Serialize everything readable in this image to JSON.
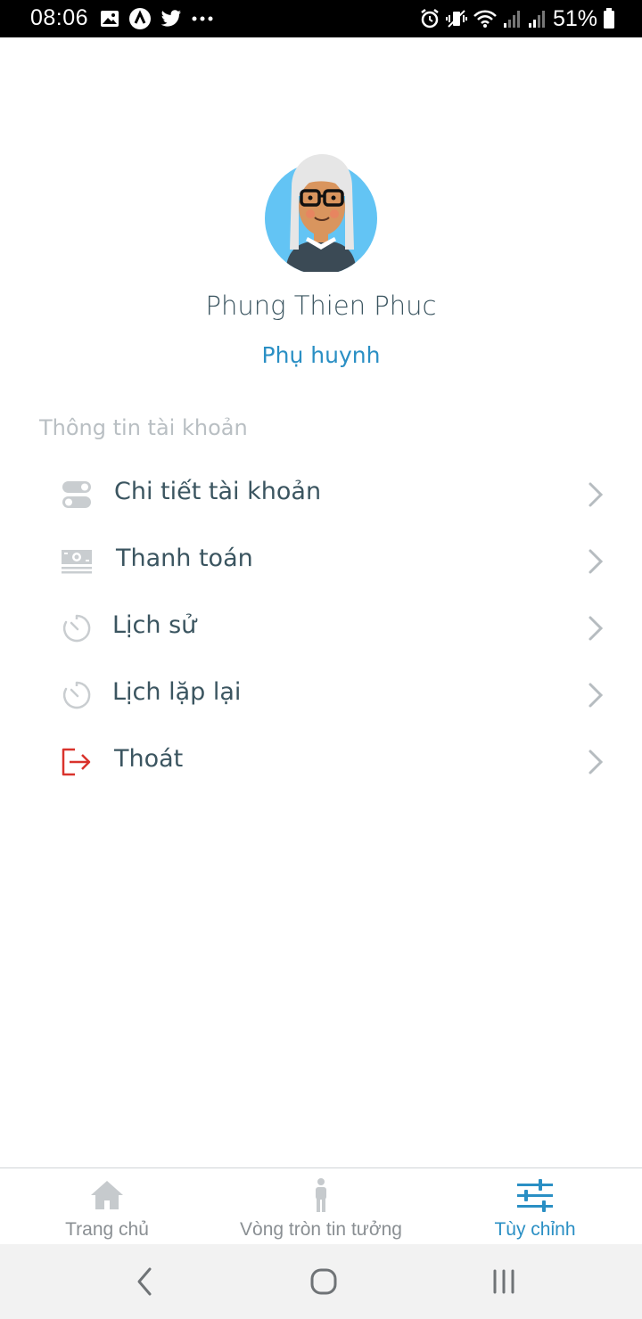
{
  "status_bar": {
    "time": "08:06",
    "battery": "51%",
    "left_icons": [
      "image-icon",
      "app-icon",
      "twitter-icon",
      "more-icon"
    ],
    "right_icons": [
      "alarm-icon",
      "vibrate-icon",
      "wifi-icon",
      "signal-icon",
      "signal-icon",
      "battery-icon"
    ]
  },
  "profile": {
    "name": "Phung Thien Phuc",
    "role": "Phụ huynh",
    "avatar_bg": "#63c4f4"
  },
  "account_section": {
    "title": "Thông tin tài khoản",
    "items": [
      {
        "label": "Chi tiết tài khoản",
        "icon": "toggle-icon"
      },
      {
        "label": "Thanh toán",
        "icon": "money-icon"
      },
      {
        "label": "Lịch sử",
        "icon": "timer-icon"
      },
      {
        "label": "Lịch lặp lại",
        "icon": "timer-icon"
      },
      {
        "label": "Thoát",
        "icon": "logout-icon"
      }
    ]
  },
  "tab_bar": {
    "tabs": [
      {
        "label": "Trang chủ",
        "icon": "home-icon",
        "active": false
      },
      {
        "label": "Vòng tròn tin tưởng",
        "icon": "person-icon",
        "active": false
      },
      {
        "label": "Tùy chỉnh",
        "icon": "sliders-icon",
        "active": true
      }
    ]
  },
  "nav_bar": {
    "buttons": [
      "back-icon",
      "home-circle-icon",
      "recent-apps-icon"
    ]
  },
  "colors": {
    "accent": "#2a8fc4",
    "text": "#3b5560",
    "muted": "#b9bfc3",
    "logout": "#d9332c"
  }
}
